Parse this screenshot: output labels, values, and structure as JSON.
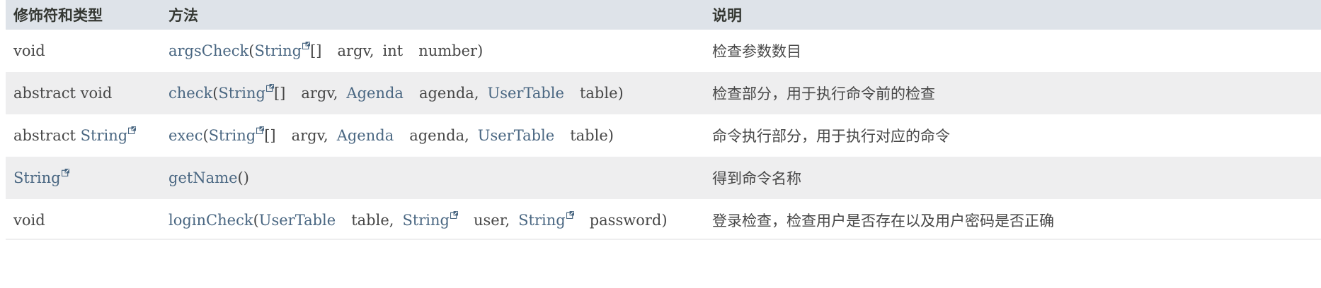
{
  "header": {
    "col1": "修饰符和类型",
    "col2": "方法",
    "col3": "说明"
  },
  "rows": [
    {
      "mod_plain": "void",
      "method": "argsCheck",
      "open": "(",
      "p1_type": "String",
      "p1_arr": "[]",
      "p1_name": "argv,",
      "p2_type": "int",
      "p2_name": "number)",
      "desc": "检查参数数目"
    },
    {
      "mod_plain": "abstract void",
      "method": "check",
      "open": "(",
      "p1_type": "String",
      "p1_arr": "[]",
      "p1_name": "argv,",
      "p2_type": "Agenda",
      "p2_name": "agenda,",
      "p3_type": "UserTable",
      "p3_name": "table)",
      "desc": "检查部分，用于执行命令前的检查"
    },
    {
      "mod_prefix": "abstract",
      "mod_type": "String",
      "method": "exec",
      "open": "(",
      "p1_type": "String",
      "p1_arr": "[]",
      "p1_name": "argv,",
      "p2_type": "Agenda",
      "p2_name": "agenda,",
      "p3_type": "UserTable",
      "p3_name": "table)",
      "desc": "命令执行部分，用于执行对应的命令"
    },
    {
      "mod_type": "String",
      "method": "getName",
      "params": "()",
      "desc": "得到命令名称"
    },
    {
      "mod_plain": "void",
      "method": "loginCheck",
      "open": "(",
      "p1_type": "UserTable",
      "p1_name": "table,",
      "p2_type": "String",
      "p2_name": "user,",
      "p3_type": "String",
      "p3_name": "password)",
      "desc": "登录检查，检查用户是否存在以及用户密码是否正确"
    }
  ],
  "colors": {
    "header_bg": "#dee3e9",
    "alt_row_bg": "#eeeeef",
    "link": "#4a6782",
    "text": "#474747"
  },
  "icons": {
    "external_link": "external-link-icon"
  }
}
